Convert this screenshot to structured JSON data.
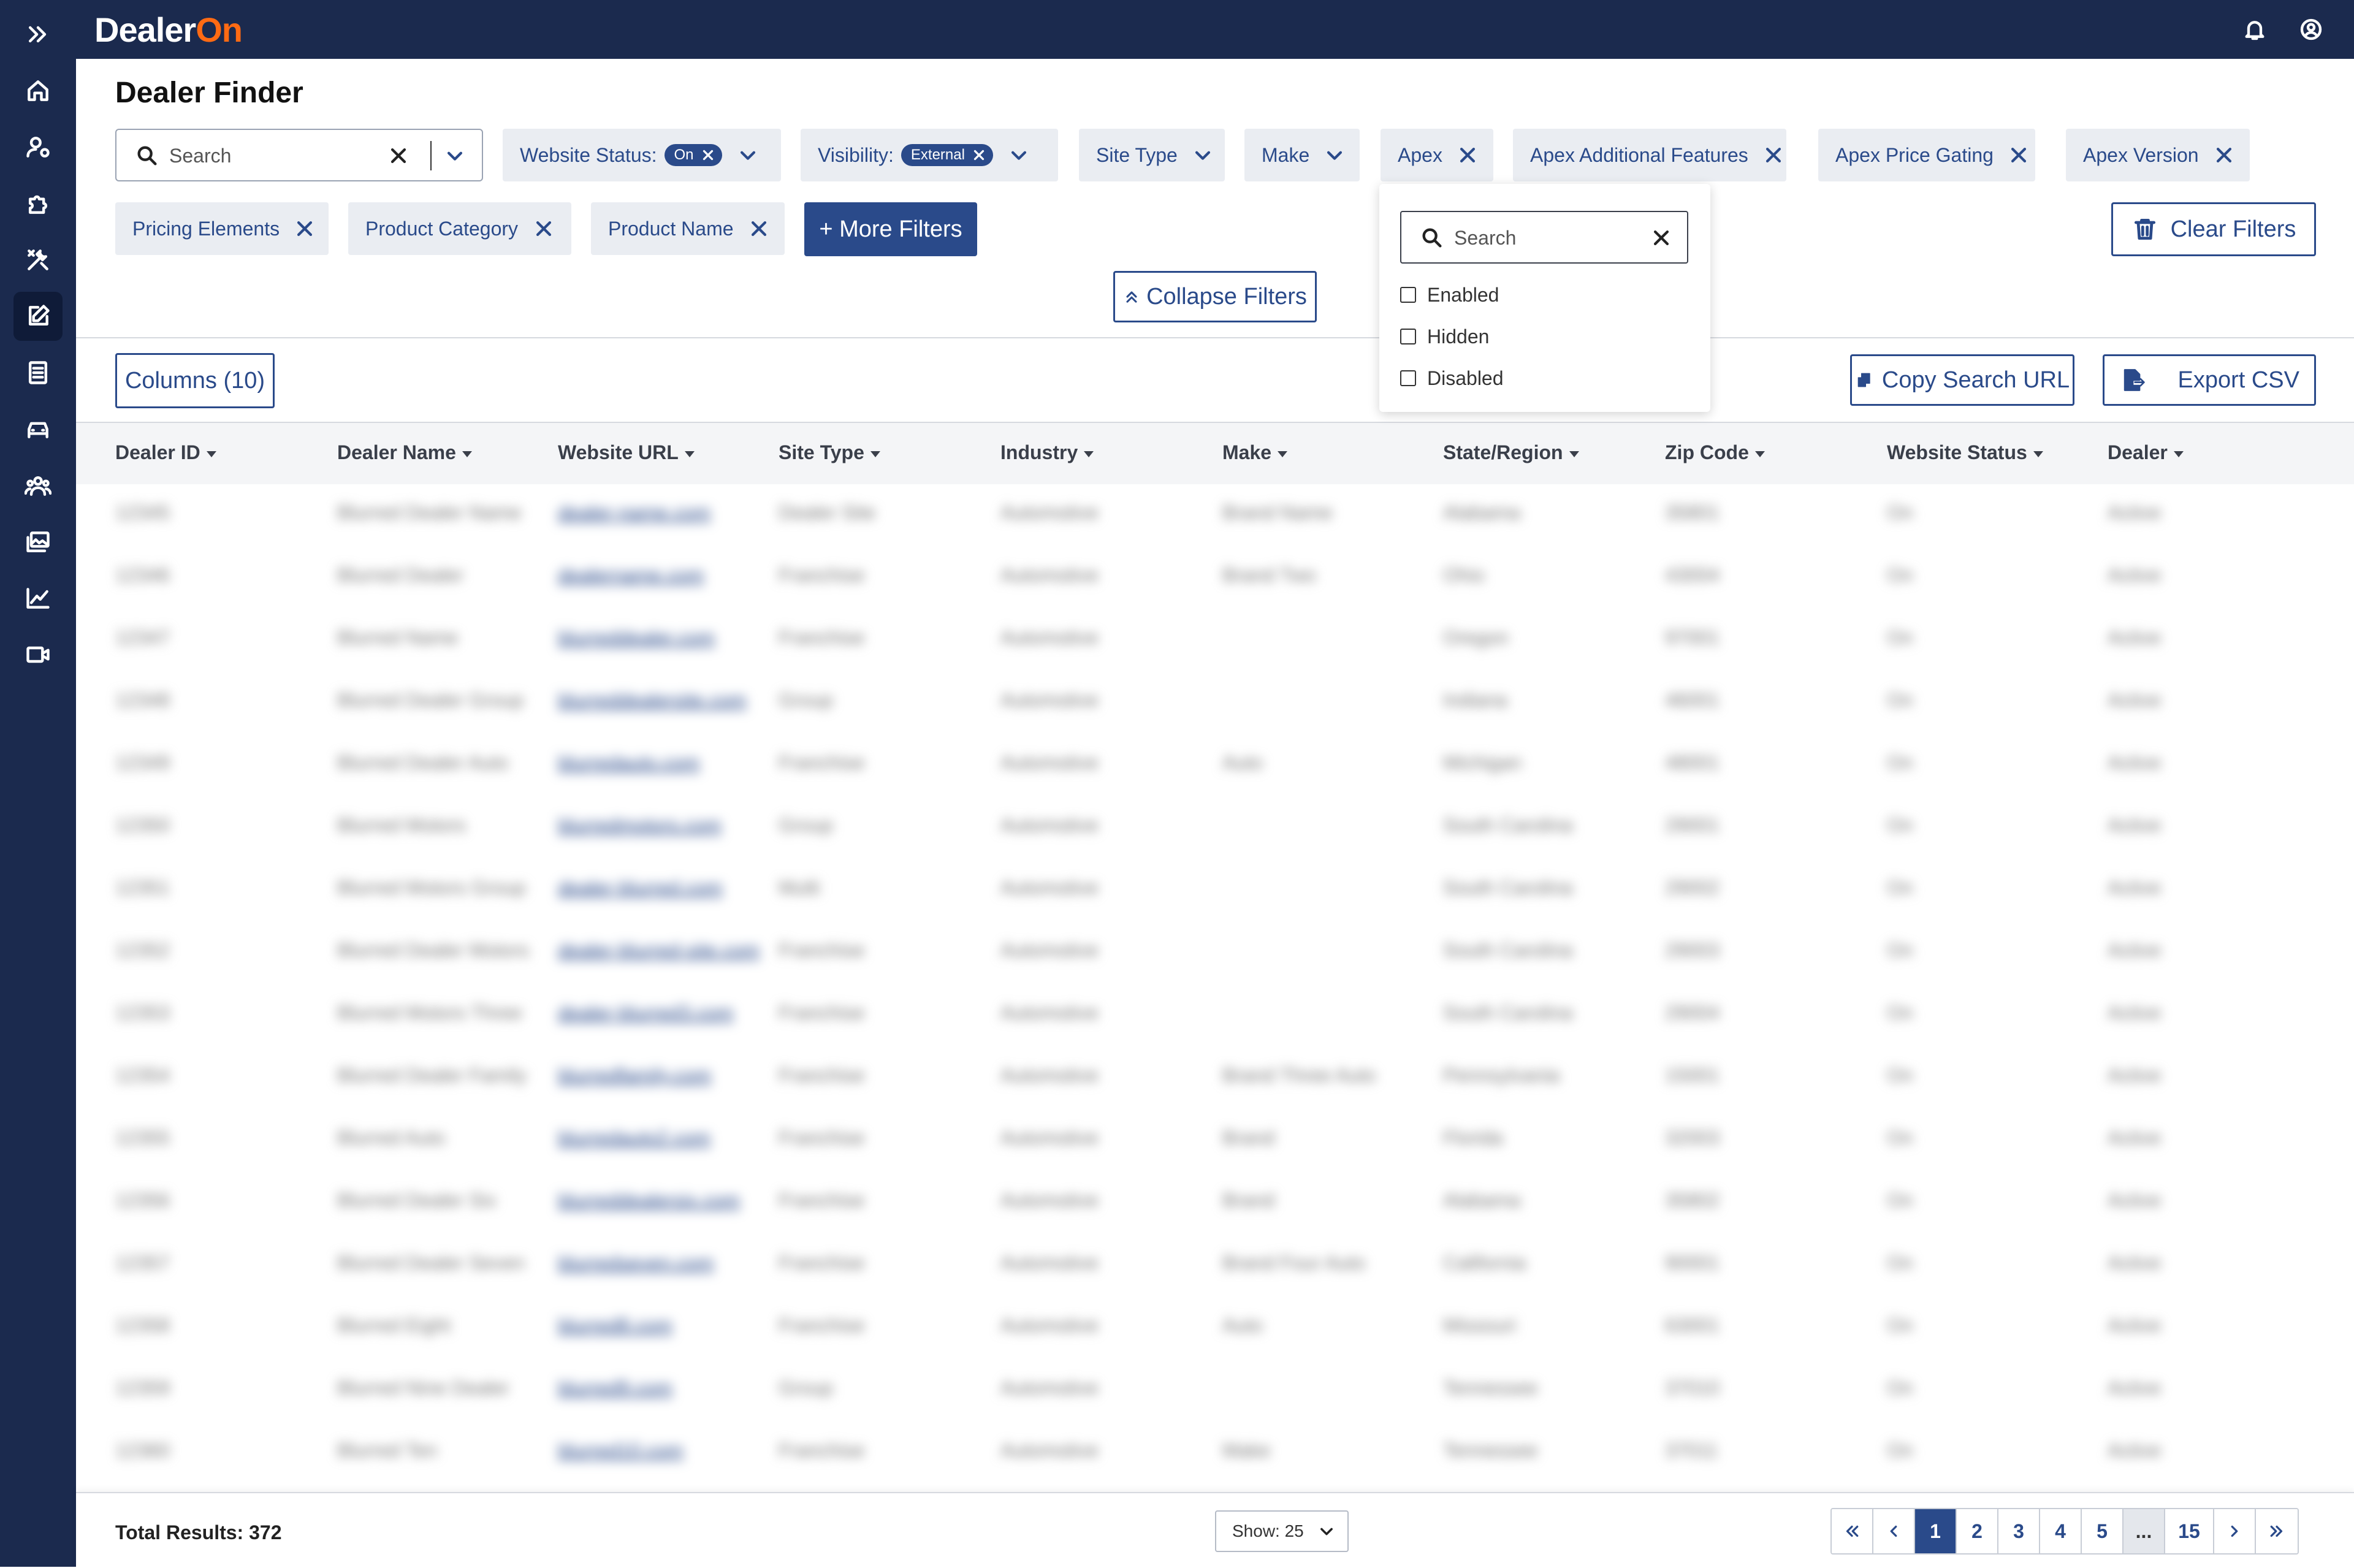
{
  "app": {
    "logo_prefix": "Dealer",
    "logo_suffix": "On"
  },
  "page": {
    "title": "Dealer Finder"
  },
  "search": {
    "placeholder": "Search"
  },
  "filters": {
    "website_status": {
      "label": "Website Status:",
      "value": "On"
    },
    "visibility": {
      "label": "Visibility:",
      "value": "External"
    },
    "site_type": "Site Type",
    "make": "Make",
    "apex": "Apex",
    "apex_additional_features": "Apex Additional Features",
    "apex_price_gating": "Apex Price Gating",
    "apex_version": "Apex Version",
    "pricing_elements": "Pricing Elements",
    "product_category": "Product Category",
    "product_name": "Product Name",
    "more_filters": "+ More Filters",
    "collapse_filters": "Collapse Filters",
    "clear_filters": "Clear Filters"
  },
  "dropdown": {
    "search_placeholder": "Search",
    "options": [
      "Enabled",
      "Hidden",
      "Disabled"
    ]
  },
  "toolbar": {
    "columns": "Columns (10)",
    "copy_url": "Copy Search URL",
    "export_csv": "Export CSV"
  },
  "table": {
    "columns": [
      "Dealer ID",
      "Dealer Name",
      "Website URL",
      "Site Type",
      "Industry",
      "Make",
      "State/Region",
      "Zip Code",
      "Website Status",
      "Dealer"
    ],
    "rows": [
      [
        "12345",
        "Blurred Dealer Name",
        "dealer-name.com",
        "Dealer Site",
        "Automotive",
        "Brand Name",
        "Alabama",
        "35801",
        "On",
        "Active"
      ],
      [
        "12346",
        "Blurred Dealer",
        "dealername.com",
        "Franchise",
        "Automotive",
        "Brand Two",
        "Ohio",
        "43004",
        "On",
        "Active"
      ],
      [
        "12347",
        "Blurred Name",
        "blurreddealer.com",
        "Franchise",
        "Automotive",
        "",
        "Oregon",
        "97001",
        "On",
        "Active"
      ],
      [
        "12348",
        "Blurred Dealer Group",
        "blurreddealersite.com",
        "Group",
        "Automotive",
        "",
        "Indiana",
        "46001",
        "On",
        "Active"
      ],
      [
        "12349",
        "Blurred Dealer Auto",
        "blurredauto.com",
        "Franchise",
        "Automotive",
        "Auto",
        "Michigan",
        "48001",
        "On",
        "Active"
      ],
      [
        "12350",
        "Blurred Motors",
        "blurredmotors.com",
        "Group",
        "Automotive",
        "",
        "South Carolina",
        "29001",
        "On",
        "Active"
      ],
      [
        "12351",
        "Blurred Motors Group",
        "dealer-blurred.com",
        "Multi",
        "Automotive",
        "",
        "South Carolina",
        "29002",
        "On",
        "Active"
      ],
      [
        "12352",
        "Blurred Dealer Motors",
        "dealer-blurred-site.com",
        "Franchise",
        "Automotive",
        "",
        "South Carolina",
        "29003",
        "On",
        "Active"
      ],
      [
        "12353",
        "Blurred Motors Three",
        "dealer-blurred3.com",
        "Franchise",
        "Automotive",
        "",
        "South Carolina",
        "29004",
        "On",
        "Active"
      ],
      [
        "12354",
        "Blurred Dealer Family",
        "blurredfamily.com",
        "Franchise",
        "Automotive",
        "Brand Three Auto",
        "Pennsylvania",
        "15001",
        "On",
        "Active"
      ],
      [
        "12355",
        "Blurred Auto",
        "blurredauto2.com",
        "Franchise",
        "Automotive",
        "Brand",
        "Florida",
        "32003",
        "On",
        "Active"
      ],
      [
        "12356",
        "Blurred Dealer Six",
        "blurreddealersix.com",
        "Franchise",
        "Automotive",
        "Brand",
        "Alabama",
        "35802",
        "On",
        "Active"
      ],
      [
        "12357",
        "Blurred Dealer Seven",
        "blurredseven.com",
        "Franchise",
        "Automotive",
        "Brand Four Auto",
        "California",
        "90001",
        "On",
        "Active"
      ],
      [
        "12358",
        "Blurred Eight",
        "blurred8.com",
        "Franchise",
        "Automotive",
        "Auto",
        "Missouri",
        "63001",
        "On",
        "Active"
      ],
      [
        "12359",
        "Blurred Nine Dealer",
        "blurred9.com",
        "Group",
        "Automotive",
        "",
        "Tennessee",
        "37010",
        "On",
        "Active"
      ],
      [
        "12360",
        "Blurred Ten",
        "blurred10.com",
        "Franchise",
        "Automotive",
        "Make",
        "Tennessee",
        "37011",
        "On",
        "Active"
      ]
    ]
  },
  "footer": {
    "total": "Total Results: 372",
    "show": "Show: 25",
    "pages": [
      "1",
      "2",
      "3",
      "4",
      "5",
      "...",
      "15"
    ],
    "current_page": "1"
  },
  "colors": {
    "navy": "#1b2a4e",
    "accent": "#2a4a8a",
    "brand_orange": "#ff6a13"
  }
}
